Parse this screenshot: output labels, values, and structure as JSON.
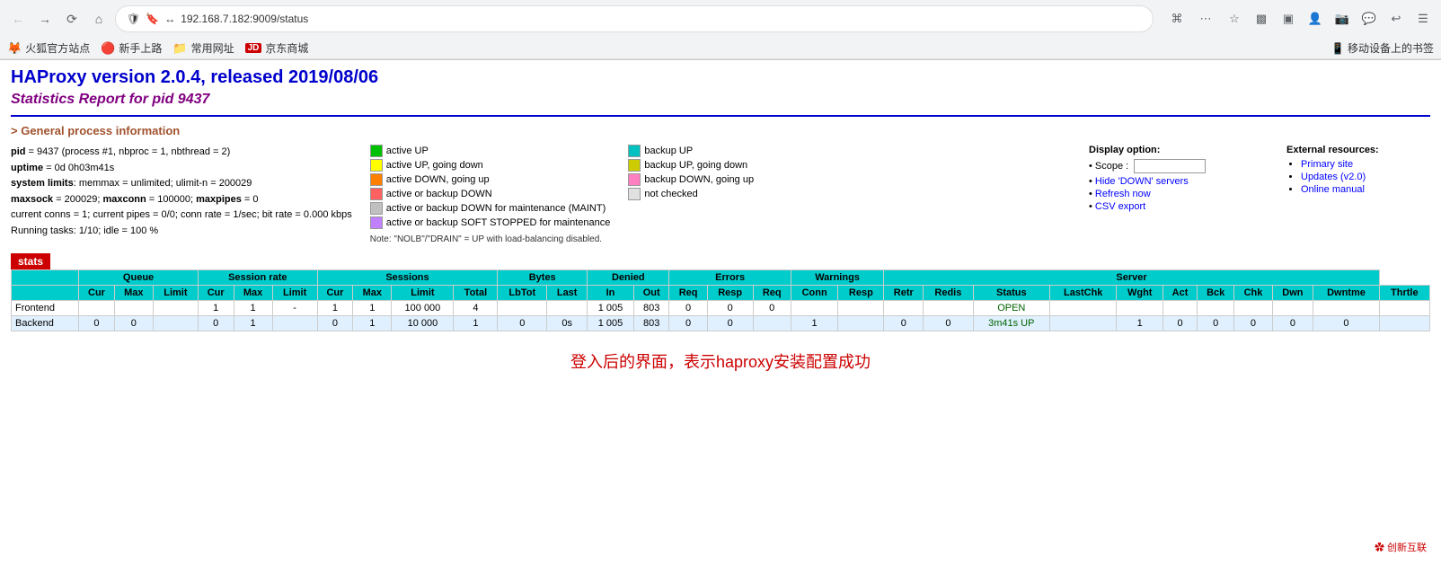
{
  "browser": {
    "back_btn": "←",
    "forward_btn": "→",
    "refresh_btn": "↻",
    "home_btn": "⌂",
    "url": "192.168.7.182:9009/status",
    "url_protocol": "🛡 🔖 ↔",
    "more_btn": "···",
    "star_btn": "☆",
    "menu_btn": "☰",
    "mobile_bookmarks": "📱 移动设备上的书签",
    "bookmarks": [
      {
        "icon": "🦊",
        "label": "火狐官方站点"
      },
      {
        "icon": "🔴",
        "label": "新手上路"
      },
      {
        "icon": "📁",
        "label": "常用网址"
      },
      {
        "icon": "🟥",
        "label": "京东商城",
        "color": "red"
      }
    ]
  },
  "page": {
    "title": "HAProxy version 2.0.4, released 2019/08/06",
    "subtitle": "Statistics Report for pid 9437",
    "section_header": "> General process information",
    "info_lines": [
      "pid = 9437 (process #1, nbproc = 1, nbthread = 2)",
      "uptime = 0d 0h03m41s",
      "system limits: memmax = unlimited; ulimit-n = 200029",
      "maxsock = 200029; maxconn = 100000; maxpipes = 0",
      "current conns = 1; current pipes = 0/0; conn rate = 1/sec; bit rate = 0.000 kbps",
      "Running tasks: 1/10; idle = 100 %"
    ],
    "legend": {
      "left_items": [
        {
          "color": "#00c000",
          "label": "active UP"
        },
        {
          "color": "#ffff00",
          "label": "active UP, going down"
        },
        {
          "color": "#ff8000",
          "label": "active DOWN, going up"
        },
        {
          "color": "#ff6060",
          "label": "active or backup DOWN"
        },
        {
          "color": "#c0c0c0",
          "label": "active or backup DOWN for maintenance (MAINT)"
        },
        {
          "color": "#c080ff",
          "label": "active or backup SOFT STOPPED for maintenance"
        }
      ],
      "right_items": [
        {
          "color": "#00c0c0",
          "label": "backup UP"
        },
        {
          "color": "#cccc00",
          "label": "backup UP, going down"
        },
        {
          "color": "#ff80c0",
          "label": "backup DOWN, going up"
        },
        {
          "color": "#e0e0e0",
          "label": "not checked"
        }
      ],
      "note": "Note: \"NOLB\"/\"DRAIN\" = UP with load-balancing disabled."
    },
    "display_option": {
      "title": "Display option:",
      "scope_label": "Scope :",
      "links": [
        {
          "label": "Hide 'DOWN' servers",
          "href": "#"
        },
        {
          "label": "Refresh now",
          "href": "#"
        },
        {
          "label": "CSV export",
          "href": "#"
        }
      ]
    },
    "external_resources": {
      "title": "External resources:",
      "links": [
        {
          "label": "Primary site",
          "href": "#"
        },
        {
          "label": "Updates (v2.0)",
          "href": "#"
        },
        {
          "label": "Online manual",
          "href": "#"
        }
      ]
    },
    "stats_label": "stats",
    "table": {
      "headers_row1": [
        "",
        "Queue",
        "",
        "",
        "Session rate",
        "",
        "",
        "Sessions",
        "",
        "",
        "",
        "Bytes",
        "",
        "Denied",
        "",
        "Errors",
        "",
        "",
        "Warnings",
        "",
        "",
        "Server",
        "",
        "",
        "",
        "",
        "",
        "",
        ""
      ],
      "headers_row2": [
        "",
        "Cur",
        "Max",
        "Limit",
        "Cur",
        "Max",
        "Limit",
        "Cur",
        "Max",
        "Limit",
        "Total",
        "LbTot",
        "Last",
        "In",
        "Out",
        "Req",
        "Resp",
        "Req",
        "Conn",
        "Resp",
        "Retr",
        "Redis",
        "Status",
        "LastChk",
        "Wght",
        "Act",
        "Bck",
        "Chk",
        "Dwn",
        "Dwntme",
        "Thrtle"
      ],
      "rows": [
        {
          "type": "frontend",
          "label": "Frontend",
          "values": [
            "",
            "",
            "",
            "1",
            "1",
            "-",
            "1",
            "1",
            "100 000",
            "4",
            "",
            "",
            "1 005",
            "803",
            "0",
            "0",
            "0",
            "",
            "",
            "",
            "",
            "OPEN",
            "",
            "",
            "",
            "",
            "",
            "",
            ""
          ]
        },
        {
          "type": "backend",
          "label": "Backend",
          "values": [
            "0",
            "0",
            "",
            "0",
            "1",
            "",
            "0",
            "1",
            "10 000",
            "1",
            "0",
            "0s",
            "1 005",
            "803",
            "0",
            "0",
            "",
            "1",
            "",
            "0",
            "0",
            "3m41s UP",
            "",
            "1",
            "0",
            "0",
            "0",
            "0",
            ""
          ]
        }
      ]
    },
    "footer_annotation": "登入后的界面，表示haproxy安装配置成功",
    "watermark": "创新互联"
  }
}
